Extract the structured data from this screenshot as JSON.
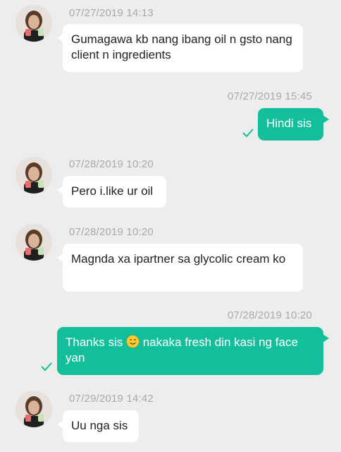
{
  "messages": [
    {
      "timestamp": "07/27/2019 14:13",
      "text": "Gumagawa kb nang ibang oil n gsto nang client n ingredients"
    },
    {
      "timestamp": "07/27/2019 15:45",
      "text": "Hindi sis"
    },
    {
      "timestamp": "07/28/2019 10:20",
      "text": "Pero i.like ur oil"
    },
    {
      "timestamp": "07/28/2019 10:20",
      "text": "Magnda xa ipartner sa glycolic  cream ko"
    },
    {
      "timestamp": "07/28/2019 10:20",
      "text_before": "Thanks sis",
      "text_after": " nakaka fresh din kasi ng face yan"
    },
    {
      "timestamp": "07/29/2019 14:42",
      "text": "Uu nga sis"
    }
  ],
  "icons": {
    "sent_check": "check-icon",
    "smile_emoji": "smiling-face-emoji"
  },
  "colors": {
    "background": "#ededed",
    "incoming_bubble": "#ffffff",
    "outgoing_bubble": "#13bf9a",
    "timestamp": "#a9a9a9",
    "check": "#13bf9a"
  }
}
